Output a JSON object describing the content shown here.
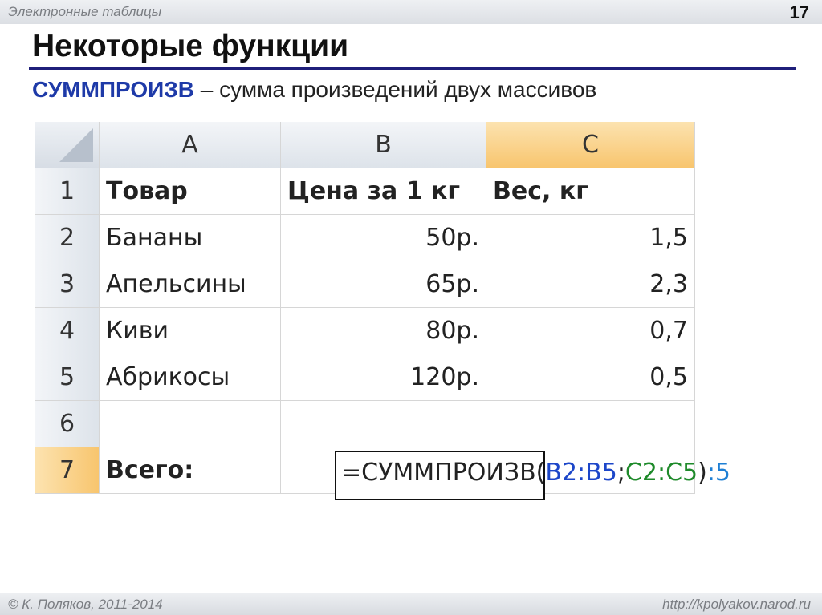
{
  "header": {
    "topic": "Электронные таблицы",
    "slide_number": "17"
  },
  "title": "Некоторые функции",
  "subtitle": {
    "function_name": "СУММПРОИЗВ",
    "description": " – сумма произведений двух массивов"
  },
  "sheet": {
    "columns": [
      "A",
      "B",
      "C"
    ],
    "selected_column": "C",
    "selected_row": "7",
    "rows": [
      {
        "n": "1",
        "a": "Товар",
        "b": "Цена за 1 кг",
        "c": "Вес, кг"
      },
      {
        "n": "2",
        "a": "Бананы",
        "b": "50р.",
        "c": "1,5"
      },
      {
        "n": "3",
        "a": "Апельсины",
        "b": "65р.",
        "c": "2,3"
      },
      {
        "n": "4",
        "a": "Киви",
        "b": "80р.",
        "c": "0,7"
      },
      {
        "n": "5",
        "a": "Абрикосы",
        "b": "120р.",
        "c": "0,5"
      },
      {
        "n": "6",
        "a": "",
        "b": "",
        "c": ""
      },
      {
        "n": "7",
        "a": "Всего:",
        "b": "",
        "c": ""
      }
    ],
    "formula": {
      "prefix": "=СУММПРОИЗВ(",
      "range1": "B2:B5",
      "sep": ";",
      "range2": "C2:C5",
      "close": ")",
      "tail": ":5"
    }
  },
  "footer": {
    "author": "© К. Поляков, 2011-2014",
    "url": "http://kpolyakov.narod.ru"
  }
}
